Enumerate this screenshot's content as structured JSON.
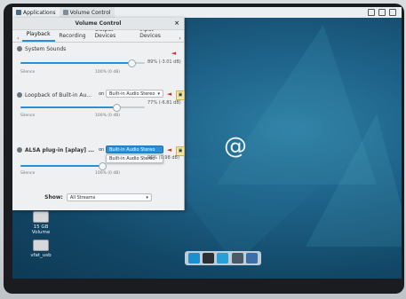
{
  "panel": {
    "applications_label": "Applications",
    "volume_control_label": "Volume Control"
  },
  "window": {
    "title": "Volume Control",
    "close_glyph": "×",
    "tabs": [
      {
        "label": "Playback",
        "selected": true
      },
      {
        "label": "Recording",
        "selected": false
      },
      {
        "label": "Output Devices",
        "selected": false
      },
      {
        "label": "Input Devices",
        "selected": false
      }
    ],
    "streams": [
      {
        "name": "System Sounds",
        "value_label": "89% (-3.01 dB)",
        "scale_left": "Silence",
        "scale_mid": "100% (0 dB)",
        "level": 0.89
      },
      {
        "name": "Loopback of Built-in Au...",
        "on_label": "on",
        "device": "Built-in Audio Stereo",
        "value_label": "77% (-6.81 dB)",
        "scale_left": "Silence",
        "scale_mid": "100% (0 dB)",
        "level": 0.77
      },
      {
        "name": "ALSA plug-in [aplay] ...",
        "on_label": "on",
        "device": "Built-in Audio Stereo",
        "popup_option": "Built-in Audio Stereo",
        "value_label": "96% (0.98 dB)",
        "scale_left": "Silence",
        "scale_mid": "100% (0 dB)",
        "level": 0.96
      }
    ],
    "show_label": "Show:",
    "show_value": "All Streams"
  },
  "desktop": {
    "icons": [
      {
        "label_line1": "15 GB",
        "label_line2": "Volume"
      },
      {
        "label_line1": "vfat_usb",
        "label_line2": ""
      }
    ]
  },
  "colors": {
    "accent": "#2b8fd6",
    "desktop": "#1e6289",
    "mute_red": "#c0392b"
  }
}
